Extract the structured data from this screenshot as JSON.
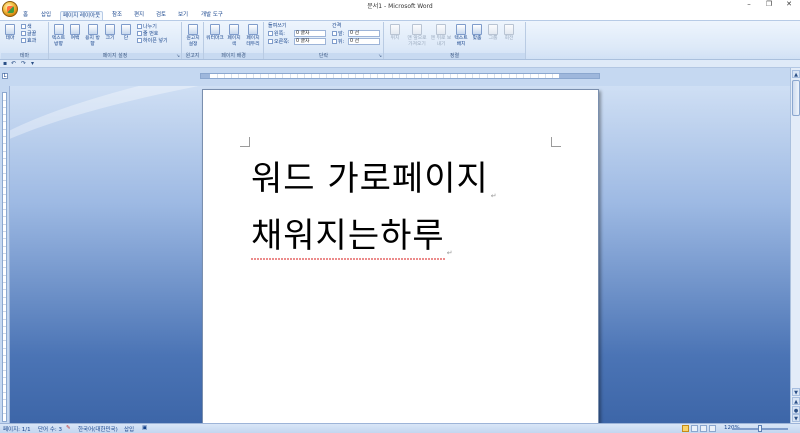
{
  "window": {
    "title": "문서1 - Microsoft Word",
    "controls": [
      "–",
      "❐",
      "✕"
    ]
  },
  "tabs": [
    "홈",
    "삽입",
    "페이지 레이아웃",
    "참조",
    "편지",
    "검토",
    "보기",
    "개발 도구"
  ],
  "active_tab": "페이지 레이아웃",
  "ribbon": {
    "groups": {
      "theme": "테마",
      "page_setup": "페이지 설정",
      "background_label": "원고지",
      "page_background": "페이지 배경",
      "paragraph": "단락",
      "arrange": "정렬"
    },
    "theme": {
      "themes_label": "테마",
      "colors": "색",
      "fonts": "글꼴",
      "effects": "효과"
    },
    "page_setup": {
      "text_direction": "텍스트 방향",
      "margins": "여백",
      "orientation": "용지 방향",
      "size": "크기",
      "columns": "단",
      "breaks": "나누기",
      "line_numbers": "줄 번호",
      "hyphenation": "하이픈 넣기"
    },
    "manuscript": "원고지 설정",
    "page_background": {
      "watermark": "워터마크",
      "page_color": "페이지 색",
      "page_borders": "페이지 테두리"
    },
    "paragraph": {
      "indent_title": "들여쓰기",
      "spacing_title": "간격",
      "indent_left_label": "왼쪽:",
      "indent_right_label": "오른쪽:",
      "indent_left_value": "0 글자",
      "indent_right_value": "0 글자",
      "spacing_before_label": "앞:",
      "spacing_after_label": "뒤:",
      "spacing_before_value": "0 선",
      "spacing_after_value": "0 선"
    },
    "arrange": {
      "position": "위치",
      "bring_front": "맨 앞으로 가져오기",
      "send_back": "맨 뒤로 보내기",
      "text_wrap": "텍스트 배치",
      "align": "맞춤",
      "group": "그룹",
      "rotate": "회전"
    }
  },
  "document": {
    "line1": "워드 가로페이지",
    "line2": "채워지는하루"
  },
  "statusbar": {
    "page": "페이지: 1/1",
    "words": "단어 수: 3",
    "language": "한국어(대한민국)",
    "insert_mode": "삽입",
    "zoom": "120%"
  }
}
